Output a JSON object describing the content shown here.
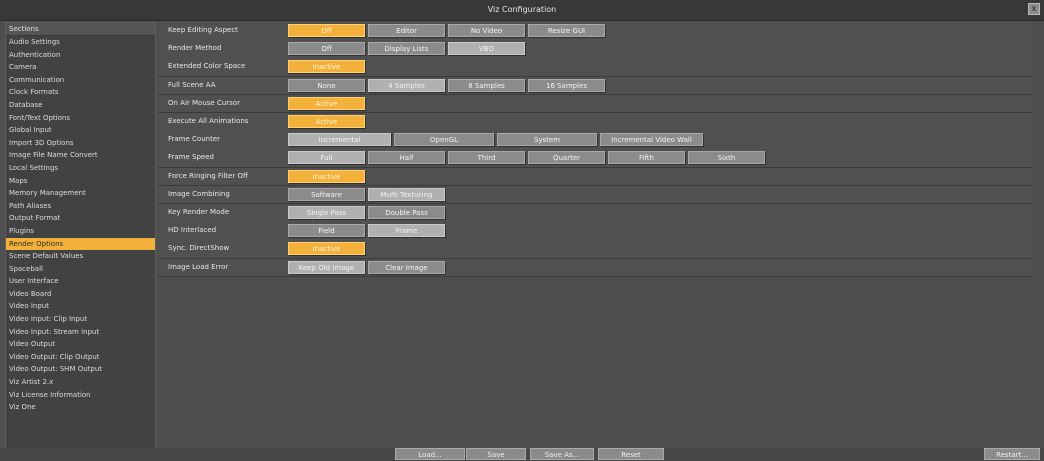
{
  "window": {
    "title": "Viz Configuration",
    "close_label": "x"
  },
  "sidebar": {
    "header": "Sections",
    "items": [
      "Audio Settings",
      "Authentication",
      "Camera",
      "Communication",
      "Clock Formats",
      "Database",
      "Font/Text Options",
      "Global Input",
      "Import 3D Options",
      "Image File Name Convert",
      "Local Settings",
      "Maps",
      "Memory Management",
      "Path Aliases",
      "Output Format",
      "Plugins",
      "Render Options",
      "Scene Default Values",
      "Spaceball",
      "User Interface",
      "Video Board",
      "Video Input",
      "Video Input: Clip Input",
      "Video Input: Stream Input",
      "Video Output",
      "Video Output: Clip Output",
      "Video Output: SHM Output",
      "Viz Artist 2.x",
      "Viz License Information",
      "Viz One"
    ],
    "selected": "Render Options"
  },
  "settings": [
    {
      "label": "Keep Editing Aspect",
      "options": [
        "Off",
        "Editor",
        "No Video",
        "Resize GUI"
      ],
      "selected": "Off"
    },
    {
      "label": "Render Method",
      "options": [
        "Off",
        "Display Lists",
        "VBO"
      ],
      "selected": "VBO"
    },
    {
      "label": "Extended Color Space",
      "options": [
        "Inactive"
      ],
      "selected": "Inactive"
    },
    {
      "label": "Full Scene AA",
      "options": [
        "None",
        "4 Samples",
        "8 Samples",
        "16 Samples"
      ],
      "selected": "4 Samples"
    },
    {
      "label": "On Air Mouse Cursor",
      "options": [
        "Active"
      ],
      "selected": "Active"
    },
    {
      "label": "Execute All Animations",
      "options": [
        "Active"
      ],
      "selected": "Active"
    },
    {
      "label": "Frame Counter",
      "options": [
        "Incremental",
        "OpenGL",
        "System",
        "Incremental Video Wall"
      ],
      "selected": "Incremental"
    },
    {
      "label": "Frame Speed",
      "options": [
        "Full",
        "Half",
        "Third",
        "Quarter",
        "Fifth",
        "Sixth"
      ],
      "selected": "Full"
    },
    {
      "label": "Force Ringing Filter Off",
      "options": [
        "Inactive"
      ],
      "selected": "Inactive"
    },
    {
      "label": "Image Combining",
      "options": [
        "Software",
        "Multi Texturing"
      ],
      "selected": "Multi Texturing"
    },
    {
      "label": "Key Render Mode",
      "options": [
        "Single Pass",
        "Double Pass"
      ],
      "selected": "Single Pass"
    },
    {
      "label": "HD Interlaced",
      "options": [
        "Field",
        "Frame"
      ],
      "selected": "Frame"
    },
    {
      "label": "Sync. DirectShow",
      "options": [
        "Inactive"
      ],
      "selected": "Inactive"
    },
    {
      "label": "Image Load Error",
      "options": [
        "Keep Old Image",
        "Clear Image"
      ],
      "selected": "Keep Old Image"
    }
  ],
  "footer": {
    "load": "Load...",
    "save": "Save",
    "save_as": "Save As...",
    "reset": "Reset",
    "restart": "Restart..."
  },
  "colors": {
    "accent": "#f3b03a",
    "button": "#8b8b8b",
    "background": "#4e4e4e"
  }
}
